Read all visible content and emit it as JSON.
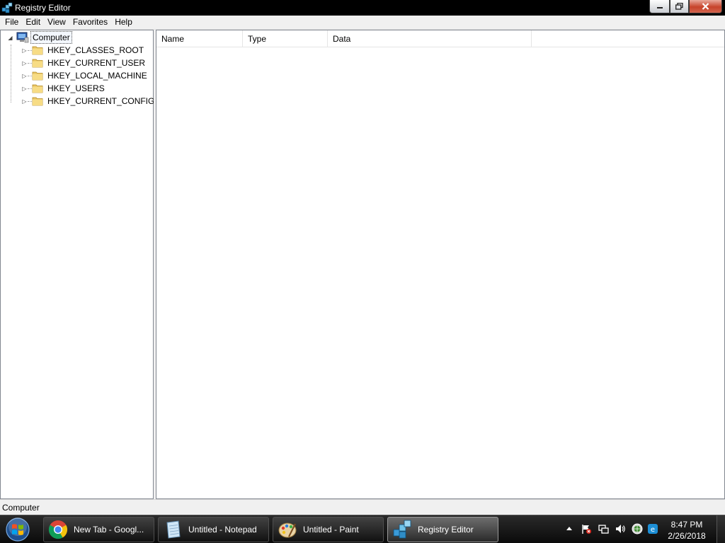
{
  "window": {
    "title": "Registry Editor",
    "close_color": "#c7432a"
  },
  "menu": [
    {
      "label": "File"
    },
    {
      "label": "Edit"
    },
    {
      "label": "View"
    },
    {
      "label": "Favorites"
    },
    {
      "label": "Help"
    }
  ],
  "tree": {
    "root": {
      "label": "Computer",
      "icon": "computer-icon"
    },
    "children": [
      {
        "label": "HKEY_CLASSES_ROOT",
        "icon": "folder-icon"
      },
      {
        "label": "HKEY_CURRENT_USER",
        "icon": "folder-icon"
      },
      {
        "label": "HKEY_LOCAL_MACHINE",
        "icon": "folder-icon"
      },
      {
        "label": "HKEY_USERS",
        "icon": "folder-icon"
      },
      {
        "label": "HKEY_CURRENT_CONFIG",
        "icon": "folder-icon"
      }
    ]
  },
  "list": {
    "columns": [
      {
        "label": "Name"
      },
      {
        "label": "Type"
      },
      {
        "label": "Data"
      }
    ]
  },
  "status": {
    "text": "Computer"
  },
  "taskbar": {
    "buttons": [
      {
        "label": "New Tab - Googl...",
        "icon": "chrome-icon"
      },
      {
        "label": "Untitled - Notepad",
        "icon": "notepad-icon"
      },
      {
        "label": "Untitled - Paint",
        "icon": "paint-icon"
      },
      {
        "label": "Registry Editor",
        "icon": "regedit-icon"
      }
    ],
    "clock": {
      "time": "8:47 PM",
      "date": "2/26/2018"
    }
  }
}
